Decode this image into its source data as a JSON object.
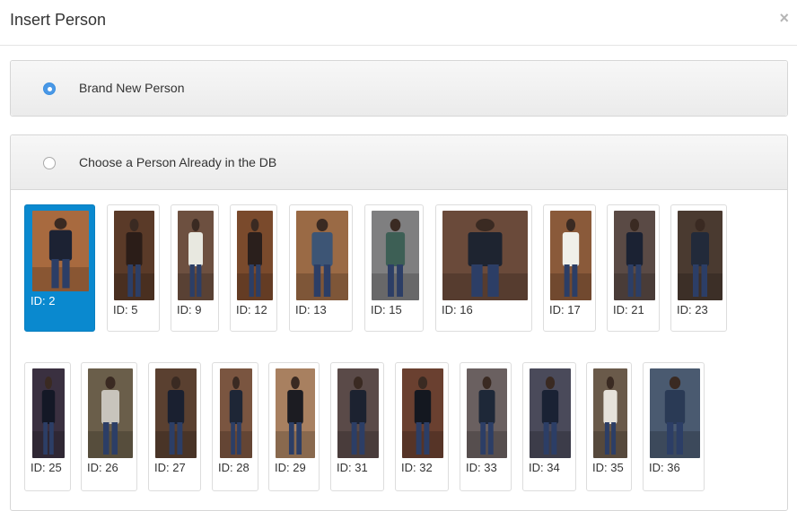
{
  "modal": {
    "title": "Insert Person",
    "close_glyph": "×"
  },
  "options": {
    "new_person": {
      "label": "Brand New Person",
      "checked": true
    },
    "existing_person": {
      "label": "Choose a Person Already in the DB",
      "checked": false
    }
  },
  "people": [
    {
      "label": "ID: 2",
      "selected": true,
      "colors": [
        "#a86a3f",
        "#1c2233"
      ]
    },
    {
      "label": "ID: 5",
      "selected": false,
      "colors": [
        "#5a3a28",
        "#2b1d18"
      ]
    },
    {
      "label": "ID: 9",
      "selected": false,
      "colors": [
        "#6d5040",
        "#e8e8e0"
      ]
    },
    {
      "label": "ID: 12",
      "selected": false,
      "colors": [
        "#7a4a2c",
        "#2a1f1c"
      ]
    },
    {
      "label": "ID: 13",
      "selected": false,
      "colors": [
        "#9a6a45",
        "#3d5575"
      ]
    },
    {
      "label": "ID: 15",
      "selected": false,
      "colors": [
        "#7f7f80",
        "#3d5f55"
      ]
    },
    {
      "label": "ID: 16",
      "selected": false,
      "colors": [
        "#6a4a3a",
        "#1e2430"
      ]
    },
    {
      "label": "ID: 17",
      "selected": false,
      "colors": [
        "#8a5a3a",
        "#f0f0ea"
      ]
    },
    {
      "label": "ID: 21",
      "selected": false,
      "colors": [
        "#5a4a45",
        "#1b2233"
      ]
    },
    {
      "label": "ID: 23",
      "selected": false,
      "colors": [
        "#4a3a30",
        "#222a3a"
      ]
    },
    {
      "label": "ID: 25",
      "selected": false,
      "colors": [
        "#3a3040",
        "#141826"
      ]
    },
    {
      "label": "ID: 26",
      "selected": false,
      "colors": [
        "#6a5e4a",
        "#c8c4bc"
      ]
    },
    {
      "label": "ID: 27",
      "selected": false,
      "colors": [
        "#5a4030",
        "#1a2030"
      ]
    },
    {
      "label": "ID: 28",
      "selected": false,
      "colors": [
        "#7a5540",
        "#1e2636"
      ]
    },
    {
      "label": "ID: 29",
      "selected": false,
      "colors": [
        "#a88060",
        "#1c1c22"
      ]
    },
    {
      "label": "ID: 31",
      "selected": false,
      "colors": [
        "#5a4a48",
        "#1c2230"
      ]
    },
    {
      "label": "ID: 32",
      "selected": false,
      "colors": [
        "#6a4030",
        "#141820"
      ]
    },
    {
      "label": "ID: 33",
      "selected": false,
      "colors": [
        "#6a6060",
        "#1e2838"
      ]
    },
    {
      "label": "ID: 34",
      "selected": false,
      "colors": [
        "#4a4a5a",
        "#1a2234"
      ]
    },
    {
      "label": "ID: 35",
      "selected": false,
      "colors": [
        "#6a5a4a",
        "#e6e2da"
      ]
    },
    {
      "label": "ID: 36",
      "selected": false,
      "colors": [
        "#4a5a70",
        "#2a3a55"
      ]
    }
  ]
}
